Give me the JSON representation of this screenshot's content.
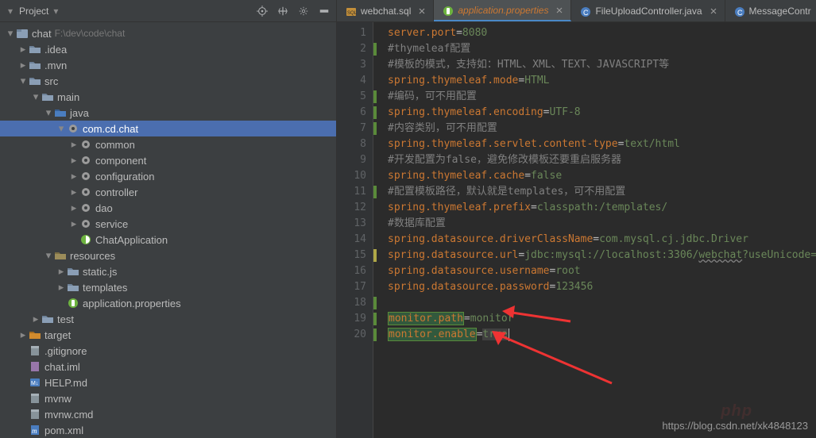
{
  "project": {
    "panel_title": "Project",
    "root_name": "chat",
    "root_path": "F:\\dev\\code\\chat",
    "tree": [
      {
        "indent": 0,
        "icon": "module",
        "label": "chat",
        "path": "F:\\dev\\code\\chat",
        "chev": "open"
      },
      {
        "indent": 1,
        "icon": "folder",
        "label": ".idea",
        "chev": "closed"
      },
      {
        "indent": 1,
        "icon": "folder",
        "label": ".mvn",
        "chev": "closed"
      },
      {
        "indent": 1,
        "icon": "folder",
        "label": "src",
        "chev": "open"
      },
      {
        "indent": 2,
        "icon": "folder",
        "label": "main",
        "chev": "open"
      },
      {
        "indent": 3,
        "icon": "src-folder",
        "label": "java",
        "chev": "open"
      },
      {
        "indent": 4,
        "icon": "pkg",
        "label": "com.cd.chat",
        "chev": "open",
        "selected": true
      },
      {
        "indent": 5,
        "icon": "pkg",
        "label": "common",
        "chev": "closed"
      },
      {
        "indent": 5,
        "icon": "pkg",
        "label": "component",
        "chev": "closed"
      },
      {
        "indent": 5,
        "icon": "pkg",
        "label": "configuration",
        "chev": "closed"
      },
      {
        "indent": 5,
        "icon": "pkg",
        "label": "controller",
        "chev": "closed"
      },
      {
        "indent": 5,
        "icon": "pkg",
        "label": "dao",
        "chev": "closed"
      },
      {
        "indent": 5,
        "icon": "pkg",
        "label": "service",
        "chev": "closed"
      },
      {
        "indent": 5,
        "icon": "spring-class",
        "label": "ChatApplication",
        "chev": "none"
      },
      {
        "indent": 3,
        "icon": "res-folder",
        "label": "resources",
        "chev": "open"
      },
      {
        "indent": 4,
        "icon": "folder",
        "label": "static.js",
        "chev": "closed"
      },
      {
        "indent": 4,
        "icon": "folder",
        "label": "templates",
        "chev": "closed"
      },
      {
        "indent": 4,
        "icon": "spring-props",
        "label": "application.properties",
        "chev": "none"
      },
      {
        "indent": 2,
        "icon": "folder",
        "label": "test",
        "chev": "closed"
      },
      {
        "indent": 1,
        "icon": "target-folder",
        "label": "target",
        "chev": "closed"
      },
      {
        "indent": 1,
        "icon": "file",
        "label": ".gitignore",
        "chev": "none"
      },
      {
        "indent": 1,
        "icon": "iml",
        "label": "chat.iml",
        "chev": "none"
      },
      {
        "indent": 1,
        "icon": "md",
        "label": "HELP.md",
        "chev": "none"
      },
      {
        "indent": 1,
        "icon": "file",
        "label": "mvnw",
        "chev": "none"
      },
      {
        "indent": 1,
        "icon": "file",
        "label": "mvnw.cmd",
        "chev": "none"
      },
      {
        "indent": 1,
        "icon": "maven",
        "label": "pom.xml",
        "chev": "none"
      }
    ]
  },
  "tabs": [
    {
      "icon": "sql",
      "label": "webchat.sql",
      "active": false
    },
    {
      "icon": "spring-props",
      "label": "application.properties",
      "active": true,
      "highlight": true
    },
    {
      "icon": "java-class",
      "label": "FileUploadController.java",
      "active": false
    },
    {
      "icon": "java-class",
      "label": "MessageContr",
      "active": false
    }
  ],
  "code": {
    "lines": [
      {
        "n": 1,
        "ind": "",
        "t": [
          [
            "key",
            "server.port"
          ],
          [
            "eq",
            "="
          ],
          [
            "val",
            "8080"
          ]
        ]
      },
      {
        "n": 2,
        "ind": "green",
        "t": [
          [
            "comment",
            "#thymeleaf配置"
          ]
        ]
      },
      {
        "n": 3,
        "ind": "",
        "t": [
          [
            "comment",
            "#模板的模式，支持如：HTML、XML、TEXT、JAVASCRIPT等"
          ]
        ]
      },
      {
        "n": 4,
        "ind": "",
        "t": [
          [
            "key",
            "spring.thymeleaf.mode"
          ],
          [
            "eq",
            "="
          ],
          [
            "val",
            "HTML"
          ]
        ]
      },
      {
        "n": 5,
        "ind": "green",
        "t": [
          [
            "comment",
            "#编码，可不用配置"
          ]
        ]
      },
      {
        "n": 6,
        "ind": "green",
        "t": [
          [
            "key",
            "spring.thymeleaf.encoding"
          ],
          [
            "eq",
            "="
          ],
          [
            "val",
            "UTF-8"
          ]
        ]
      },
      {
        "n": 7,
        "ind": "green",
        "t": [
          [
            "comment",
            "#内容类别，可不用配置"
          ]
        ]
      },
      {
        "n": 8,
        "ind": "",
        "t": [
          [
            "key",
            "spring.thymeleaf.servlet.content-type"
          ],
          [
            "eq",
            "="
          ],
          [
            "val",
            "text/html"
          ]
        ]
      },
      {
        "n": 9,
        "ind": "",
        "t": [
          [
            "comment",
            "#开发配置为false，避免修改模板还要重启服务器"
          ]
        ]
      },
      {
        "n": 10,
        "ind": "",
        "t": [
          [
            "key",
            "spring.thymeleaf.cache"
          ],
          [
            "eq",
            "="
          ],
          [
            "val",
            "false"
          ]
        ]
      },
      {
        "n": 11,
        "ind": "green",
        "t": [
          [
            "comment",
            "#配置模板路径，默认就是templates，可不用配置"
          ]
        ]
      },
      {
        "n": 12,
        "ind": "",
        "t": [
          [
            "key",
            "spring.thymeleaf.prefix"
          ],
          [
            "eq",
            "="
          ],
          [
            "val",
            "classpath:/templates/"
          ]
        ]
      },
      {
        "n": 13,
        "ind": "",
        "t": [
          [
            "comment",
            "#数据库配置"
          ]
        ]
      },
      {
        "n": 14,
        "ind": "",
        "t": [
          [
            "key",
            "spring.datasource.driverClassName"
          ],
          [
            "eq",
            "="
          ],
          [
            "val",
            "com.mysql.cj.jdbc.Driver"
          ]
        ]
      },
      {
        "n": 15,
        "ind": "yellow",
        "t": [
          [
            "key",
            "spring.datasource.url"
          ],
          [
            "eq",
            "="
          ],
          [
            "val",
            "jdbc:mysql://localhost:3306/"
          ],
          [
            "err",
            "webchat"
          ],
          [
            "val",
            "?useUnicode=true&zero"
          ]
        ]
      },
      {
        "n": 16,
        "ind": "",
        "t": [
          [
            "key",
            "spring.datasource.username"
          ],
          [
            "eq",
            "="
          ],
          [
            "val",
            "root"
          ]
        ]
      },
      {
        "n": 17,
        "ind": "",
        "t": [
          [
            "key",
            "spring.datasource.password"
          ],
          [
            "eq",
            "="
          ],
          [
            "val",
            "123456"
          ]
        ]
      },
      {
        "n": 18,
        "ind": "green",
        "t": []
      },
      {
        "n": 19,
        "ind": "green",
        "t": [
          [
            "occ",
            "monitor.path"
          ],
          [
            "eq",
            "="
          ],
          [
            "val",
            "monitor"
          ]
        ]
      },
      {
        "n": 20,
        "ind": "green",
        "t": [
          [
            "occ",
            "monitor.enable"
          ],
          [
            "eq",
            "="
          ],
          [
            "val-hl",
            "true"
          ]
        ],
        "caret": true
      }
    ]
  },
  "watermark": "https://blog.csdn.net/xk4848123",
  "php_wm": "php"
}
